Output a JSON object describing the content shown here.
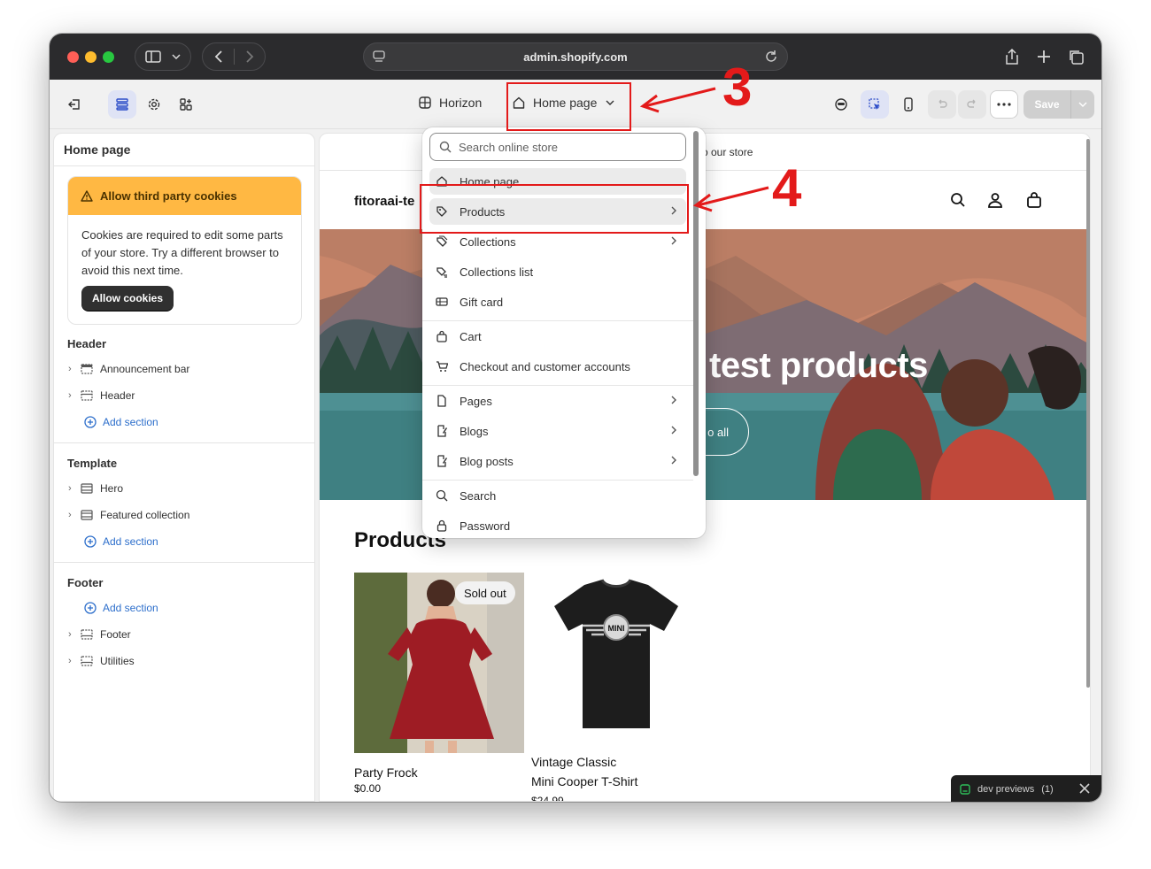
{
  "browser": {
    "url": "admin.shopify.com"
  },
  "toolbar": {
    "theme_name": "Horizon",
    "page_label": "Home page",
    "save_label": "Save"
  },
  "sidebar": {
    "title": "Home page",
    "cookie_banner": {
      "title": "Allow third party cookies",
      "body": "Cookies are required to edit some parts of your store. Try a different browser to avoid this next time.",
      "button": "Allow cookies"
    },
    "groups": [
      {
        "title": "Header",
        "items": [
          "Announcement bar",
          "Header"
        ],
        "add": "Add section"
      },
      {
        "title": "Template",
        "items": [
          "Hero",
          "Featured collection"
        ],
        "add": "Add section"
      },
      {
        "title": "Footer",
        "add": "Add section",
        "items": [
          "Footer",
          "Utilities"
        ]
      }
    ]
  },
  "preview": {
    "announcement": "o our store",
    "store_name": "fitoraai-te",
    "hero_title": "test products",
    "hero_button": "o all",
    "products_heading": "Products",
    "products": [
      {
        "name": "Party Frock",
        "price": "$0.00",
        "badge": "Sold out"
      },
      {
        "name": "Vintage Classic",
        "name2": "Mini Cooper T-Shirt",
        "price": "$24.99",
        "logo_text": "MINI"
      }
    ]
  },
  "menu": {
    "search_placeholder": "Search online store",
    "items": [
      {
        "label": "Home page",
        "icon": "home-icon"
      },
      {
        "label": "Products",
        "icon": "tag-icon",
        "chevron": true
      },
      {
        "label": "Collections",
        "icon": "collection-icon",
        "chevron": true
      },
      {
        "label": "Collections list",
        "icon": "collections-list-icon"
      },
      {
        "label": "Gift card",
        "icon": "gift-card-icon"
      },
      {
        "label": "Cart",
        "icon": "bag-icon"
      },
      {
        "label": "Checkout and customer accounts",
        "icon": "cart-icon"
      },
      {
        "label": "Pages",
        "icon": "page-icon",
        "chevron": true
      },
      {
        "label": "Blogs",
        "icon": "blog-icon",
        "chevron": true
      },
      {
        "label": "Blog posts",
        "icon": "blog-post-icon",
        "chevron": true
      },
      {
        "label": "Search",
        "icon": "search-icon"
      },
      {
        "label": "Password",
        "icon": "lock-icon"
      }
    ]
  },
  "annotations": {
    "step3": "3",
    "step4": "4",
    "color": "#e31a1a"
  },
  "dev_toast": {
    "label": "dev previews",
    "count": "(1)"
  }
}
